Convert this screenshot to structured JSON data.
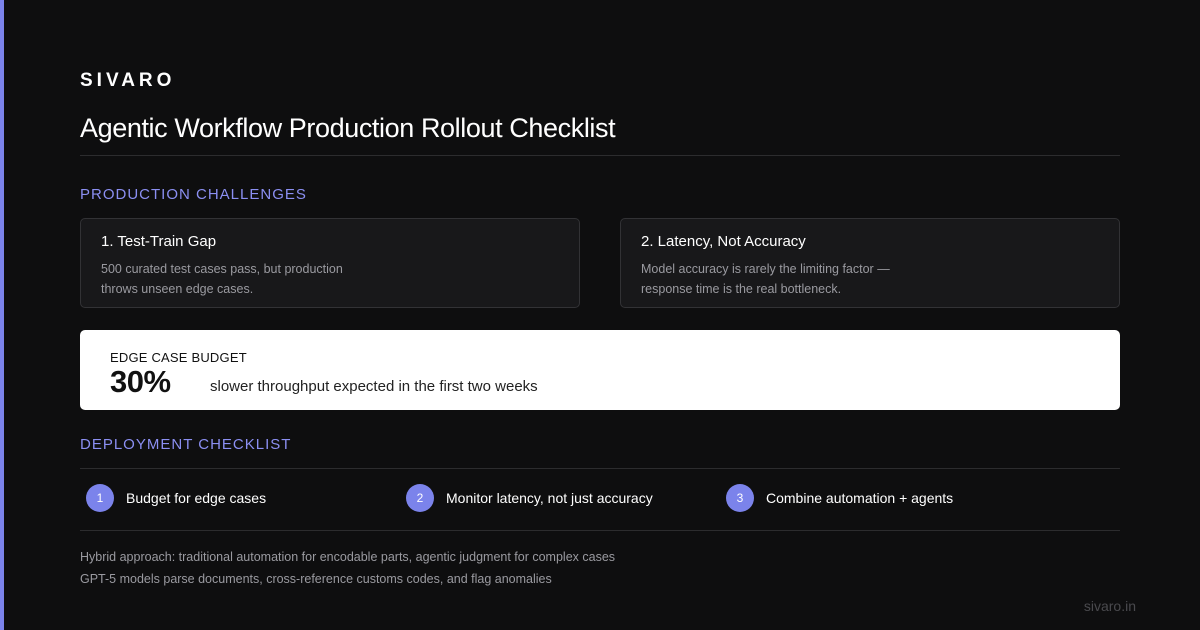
{
  "brand": "SIVARO",
  "title": "Agentic Workflow Production Rollout Checklist",
  "challenges": {
    "heading": "PRODUCTION CHALLENGES",
    "cards": [
      {
        "title": "1. Test-Train Gap",
        "lines": [
          "500 curated test cases pass, but production",
          "throws unseen edge cases."
        ]
      },
      {
        "title": "2. Latency, Not Accuracy",
        "lines": [
          "Model accuracy is rarely the limiting factor —",
          "response time is the real bottleneck."
        ]
      }
    ]
  },
  "budget": {
    "label": "EDGE CASE BUDGET",
    "value": "30%",
    "description": "slower throughput expected in the first two weeks"
  },
  "checklist": {
    "heading": "DEPLOYMENT CHECKLIST",
    "steps": [
      {
        "number": "1",
        "text": "Budget for edge cases"
      },
      {
        "number": "2",
        "text": "Monitor latency, not just accuracy"
      },
      {
        "number": "3",
        "text": "Combine automation + agents"
      }
    ]
  },
  "notes": [
    "Hybrid approach: traditional automation for encodable parts, agentic judgment for complex cases",
    "GPT-5 models parse documents, cross-reference customs codes, and flag anomalies"
  ],
  "footer": {
    "url": "sivaro.in"
  },
  "colors": {
    "accent": "#7b83eb",
    "background": "#0e0e0f",
    "card": "#18181a"
  }
}
